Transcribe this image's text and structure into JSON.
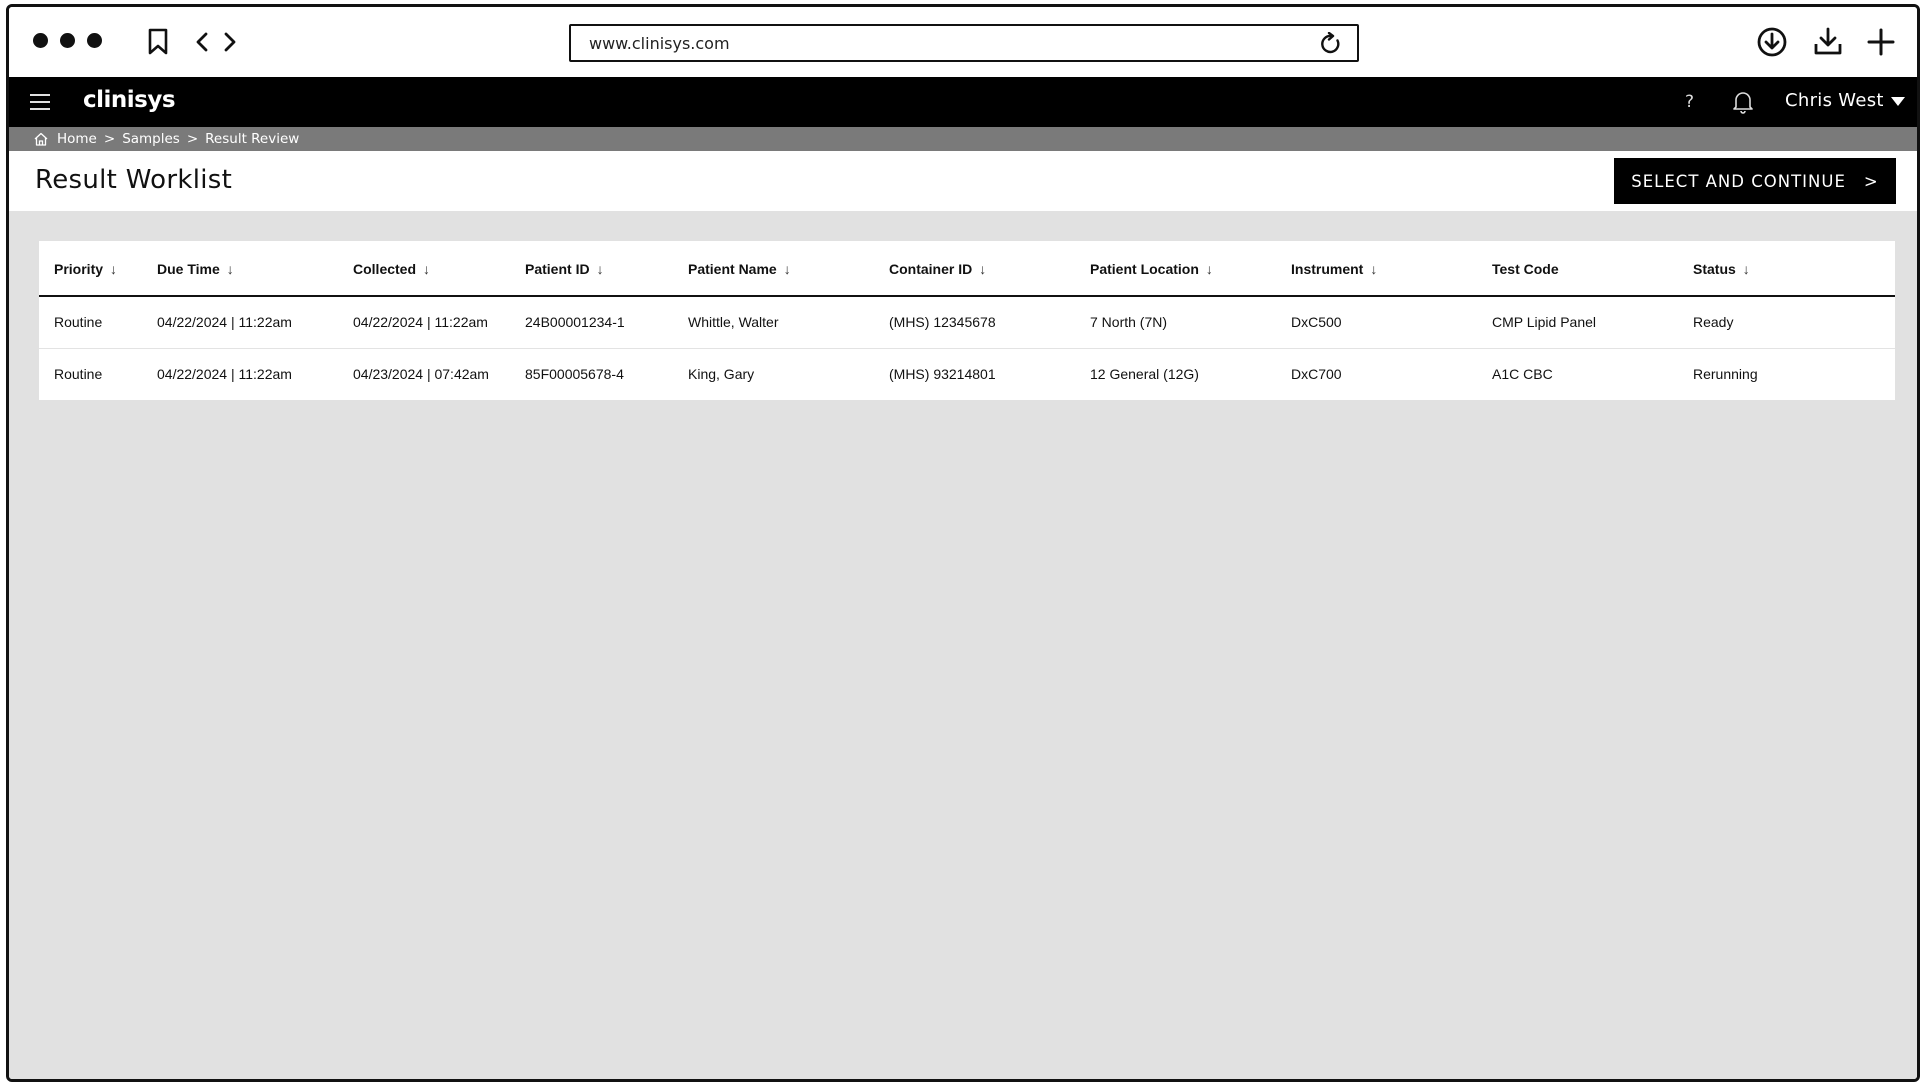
{
  "browser": {
    "url": "www.clinisys.com"
  },
  "app": {
    "logo": "clinisys",
    "help_label": "?",
    "user_name": "Chris West"
  },
  "breadcrumb": {
    "items": [
      "Home",
      "Samples",
      "Result Review"
    ],
    "separator": ">"
  },
  "page": {
    "title": "Result Worklist",
    "primary_action": "SELECT AND CONTINUE",
    "primary_action_chevron": ">"
  },
  "table": {
    "sort_glyph": "↓",
    "columns": [
      {
        "label": "Priority",
        "sortable": true
      },
      {
        "label": "Due Time",
        "sortable": true
      },
      {
        "label": "Collected",
        "sortable": true
      },
      {
        "label": "Patient ID",
        "sortable": true
      },
      {
        "label": "Patient Name",
        "sortable": true
      },
      {
        "label": "Container ID",
        "sortable": true
      },
      {
        "label": "Patient Location",
        "sortable": true
      },
      {
        "label": "Instrument",
        "sortable": true
      },
      {
        "label": "Test Code",
        "sortable": false
      },
      {
        "label": "Status",
        "sortable": true
      }
    ],
    "rows": [
      [
        "Routine",
        "04/22/2024 | 11:22am",
        "04/22/2024 | 11:22am",
        "24B00001234-1",
        "Whittle, Walter",
        "(MHS) 12345678",
        "7 North (7N)",
        "DxC500",
        "CMP Lipid Panel",
        "Ready"
      ],
      [
        "Routine",
        "04/22/2024 | 11:22am",
        "04/23/2024 | 07:42am",
        "85F00005678-4",
        "King, Gary",
        "(MHS) 93214801",
        "12 General (12G)",
        "DxC700",
        "A1C CBC",
        "Rerunning"
      ]
    ]
  },
  "colors": {
    "header_bg": "#000000",
    "breadcrumb_bg": "#7a7a7a",
    "content_bg": "#e1e1e1",
    "cta_bg": "#000000"
  },
  "icons": {
    "window_controls": "three-dots-icon",
    "bookmark": "bookmark-icon",
    "back": "chevron-left-icon",
    "forward": "chevron-right-icon",
    "reload": "reload-icon",
    "download_circle": "download-circle-icon",
    "download_tray": "download-tray-icon",
    "new_tab": "plus-icon",
    "menu": "hamburger-icon",
    "notifications": "bell-icon",
    "user_menu": "caret-down-icon",
    "home": "home-icon"
  }
}
